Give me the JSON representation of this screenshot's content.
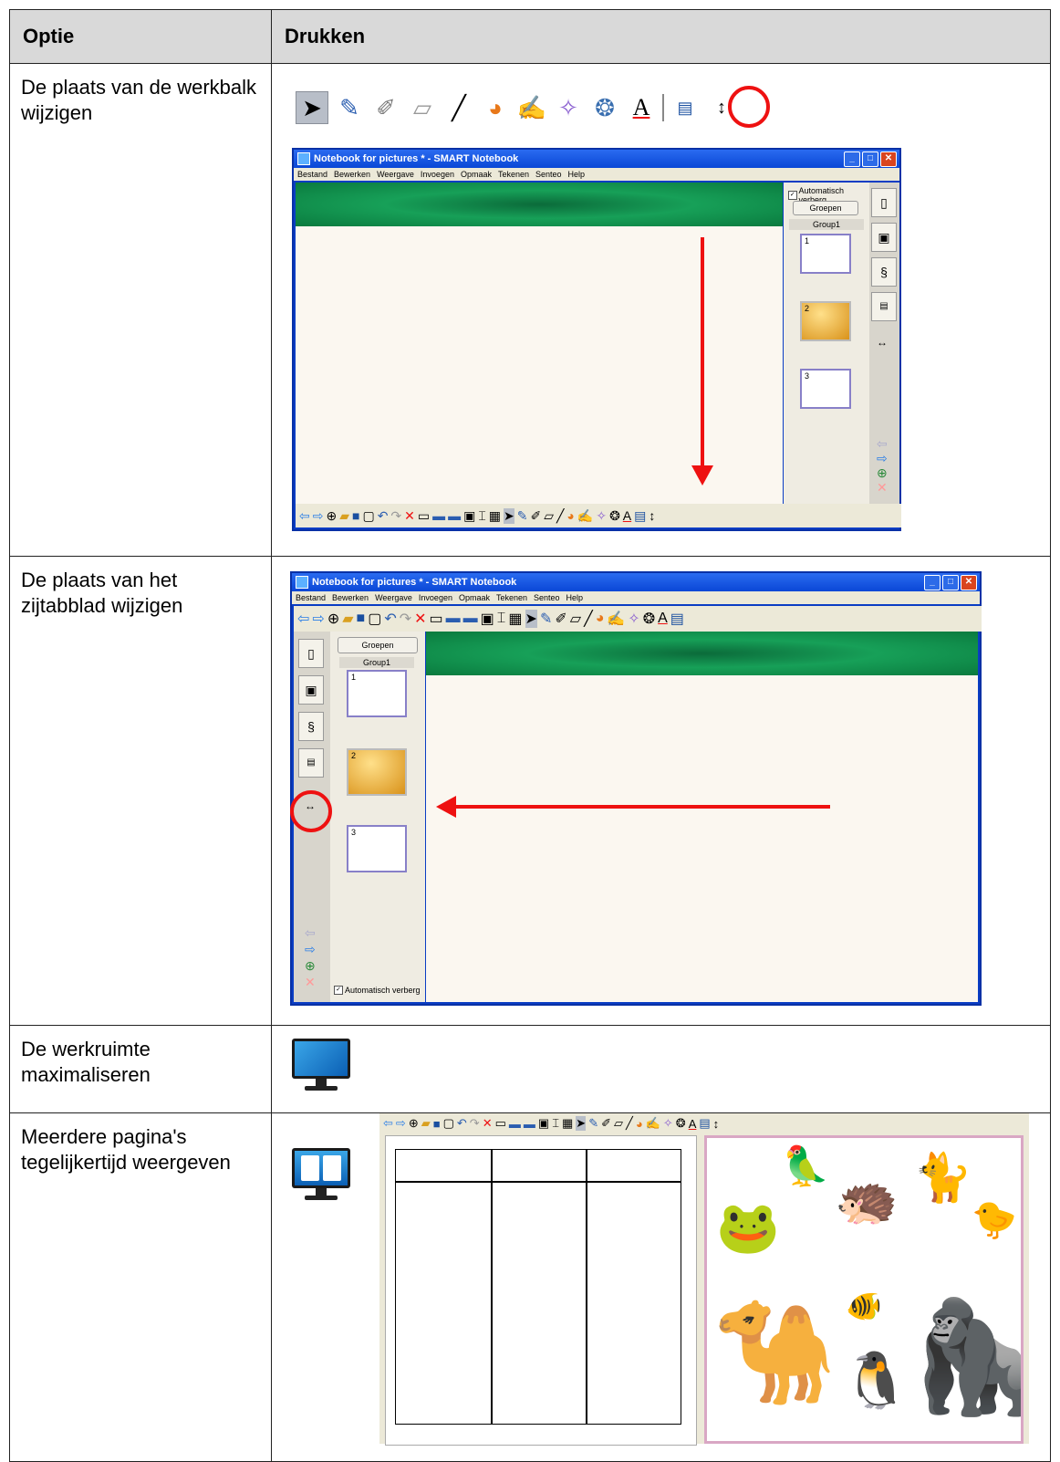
{
  "table": {
    "header": {
      "col1": "Optie",
      "col2": "Drukken"
    },
    "rows": [
      {
        "option": "De plaats van de werkbalk wijzigen"
      },
      {
        "option": "De plaats van het zijtabblad wijzigen"
      },
      {
        "option": "De werkruimte maximaliseren"
      },
      {
        "option": "Meerdere pagina's tegelijkertijd weergeven"
      }
    ]
  },
  "window": {
    "title": "Notebook for pictures * - SMART Notebook",
    "menu": [
      "Bestand",
      "Bewerken",
      "Weergave",
      "Invoegen",
      "Opmaak",
      "Tekenen",
      "Senteo",
      "Help"
    ],
    "auto_hide": "Automatisch verberg",
    "groups_button": "Groepen",
    "group_label": "Group1",
    "page_numbers": [
      "1",
      "2",
      "3"
    ]
  },
  "icons": {
    "toolbar": [
      "select-icon",
      "pen-icon",
      "creative-pen-icon",
      "eraser-icon",
      "line-icon",
      "shapes-icon",
      "magic-pen-icon",
      "fill-icon",
      "text-icon",
      "properties-icon",
      "move-toolbar-icon"
    ],
    "colors": {
      "accent_red": "#e11111",
      "banner_green": "#17a058",
      "header_gray": "#d9d9d9"
    }
  }
}
